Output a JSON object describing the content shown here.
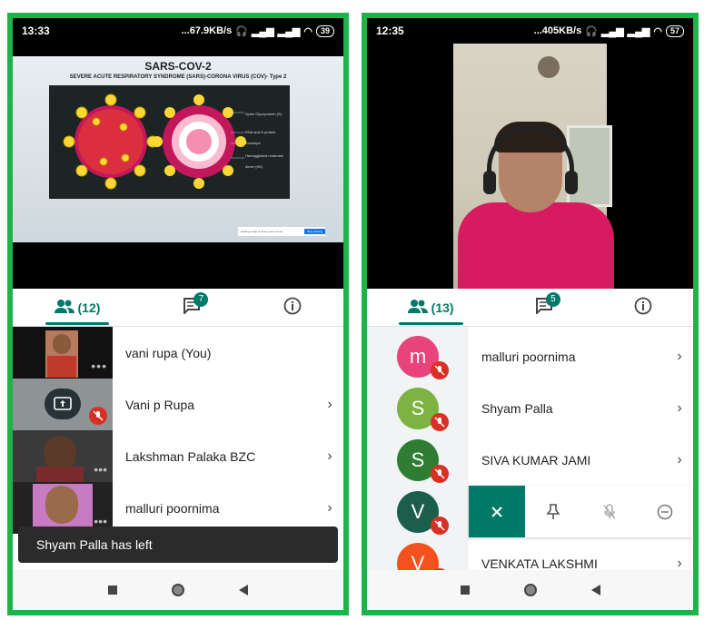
{
  "left": {
    "status": {
      "time": "13:33",
      "net": "...67.9KB/s",
      "battery": "39"
    },
    "slide": {
      "title": "SARS-COV-2",
      "subtitle": "SEVERE ACUTE RESPIRATORY SYNDROME (SARS)-CORONA VIRUS (COV)- Type 2",
      "labels": [
        "Spike Glycoprotein (S)",
        "RNA and N protein",
        "Envelope",
        "Hemagglutinin esterase dimer (HE)"
      ],
      "notice": "Getting ready to share your screen",
      "notice_button": "Stop sharing"
    },
    "tabs": {
      "people_count": "(12)",
      "chat_badge": "7"
    },
    "participants": [
      {
        "name": "vani rupa (You)"
      },
      {
        "name": "Vani p Rupa"
      },
      {
        "name": "Lakshman Palaka BZC"
      },
      {
        "name": "malluri poornima"
      }
    ],
    "toast": "Shyam Palla has left"
  },
  "right": {
    "status": {
      "time": "12:35",
      "net": "...405KB/s",
      "battery": "57"
    },
    "tabs": {
      "people_count": "(13)",
      "chat_badge": "5"
    },
    "participants": [
      {
        "initial": "m",
        "name": "malluri poornima",
        "color": "#e8437a"
      },
      {
        "initial": "S",
        "name": "Shyam Palla",
        "color": "#7cb342"
      },
      {
        "initial": "S",
        "name": "SIVA KUMAR JAMI",
        "color": "#2e7d32"
      },
      {
        "initial": "V",
        "name": "",
        "color": "#1b5e4a"
      },
      {
        "initial": "V",
        "name": "VENKATA LAKSHMI",
        "color": "#f4511e"
      }
    ]
  },
  "colors": {
    "frame": "#1db34a",
    "accent": "#00796b",
    "mute": "#d93025"
  }
}
